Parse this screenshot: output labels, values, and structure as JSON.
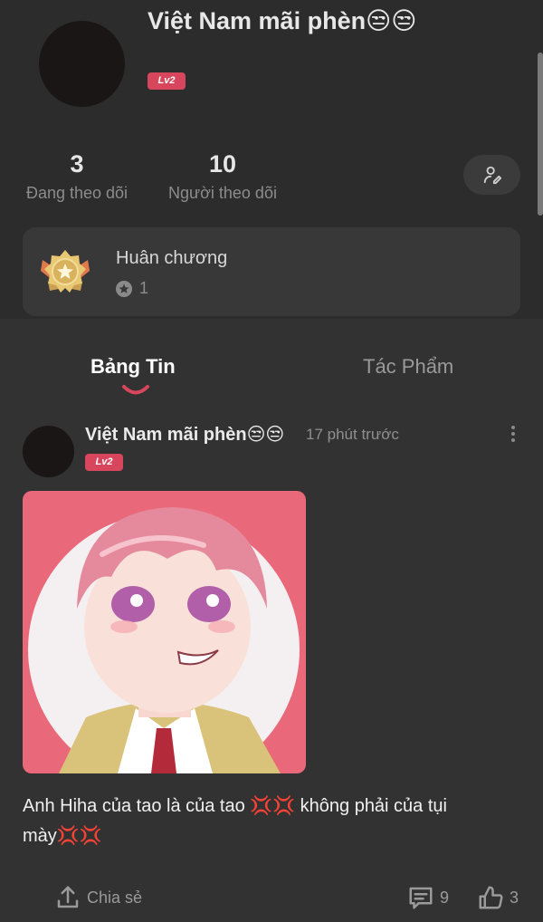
{
  "profile": {
    "username": "Việt Nam mãi phèn😒😒",
    "level": "Lv2",
    "following_count": "3",
    "following_label": "Đang theo dõi",
    "followers_count": "10",
    "followers_label": "Người theo dõi",
    "edit_icon": "person-edit-icon"
  },
  "medals": {
    "title": "Huân chương",
    "count": "1",
    "icon": "medal-icon"
  },
  "tabs": [
    {
      "label": "Bảng Tin",
      "active": true
    },
    {
      "label": "Tác Phẩm",
      "active": false
    }
  ],
  "post": {
    "author": "Việt Nam mãi phèn😒😒",
    "time": "17 phút trước",
    "level": "Lv2",
    "text": "Anh Hiha của tao là của tao 💢💢 không phải của tụi mày💢💢",
    "share_label": "Chia sẻ",
    "comment_count": "9",
    "like_count": "3"
  },
  "colors": {
    "background": "#323232",
    "header_background": "#2c2c2c",
    "accent": "#d8465d",
    "card": "#383838"
  }
}
